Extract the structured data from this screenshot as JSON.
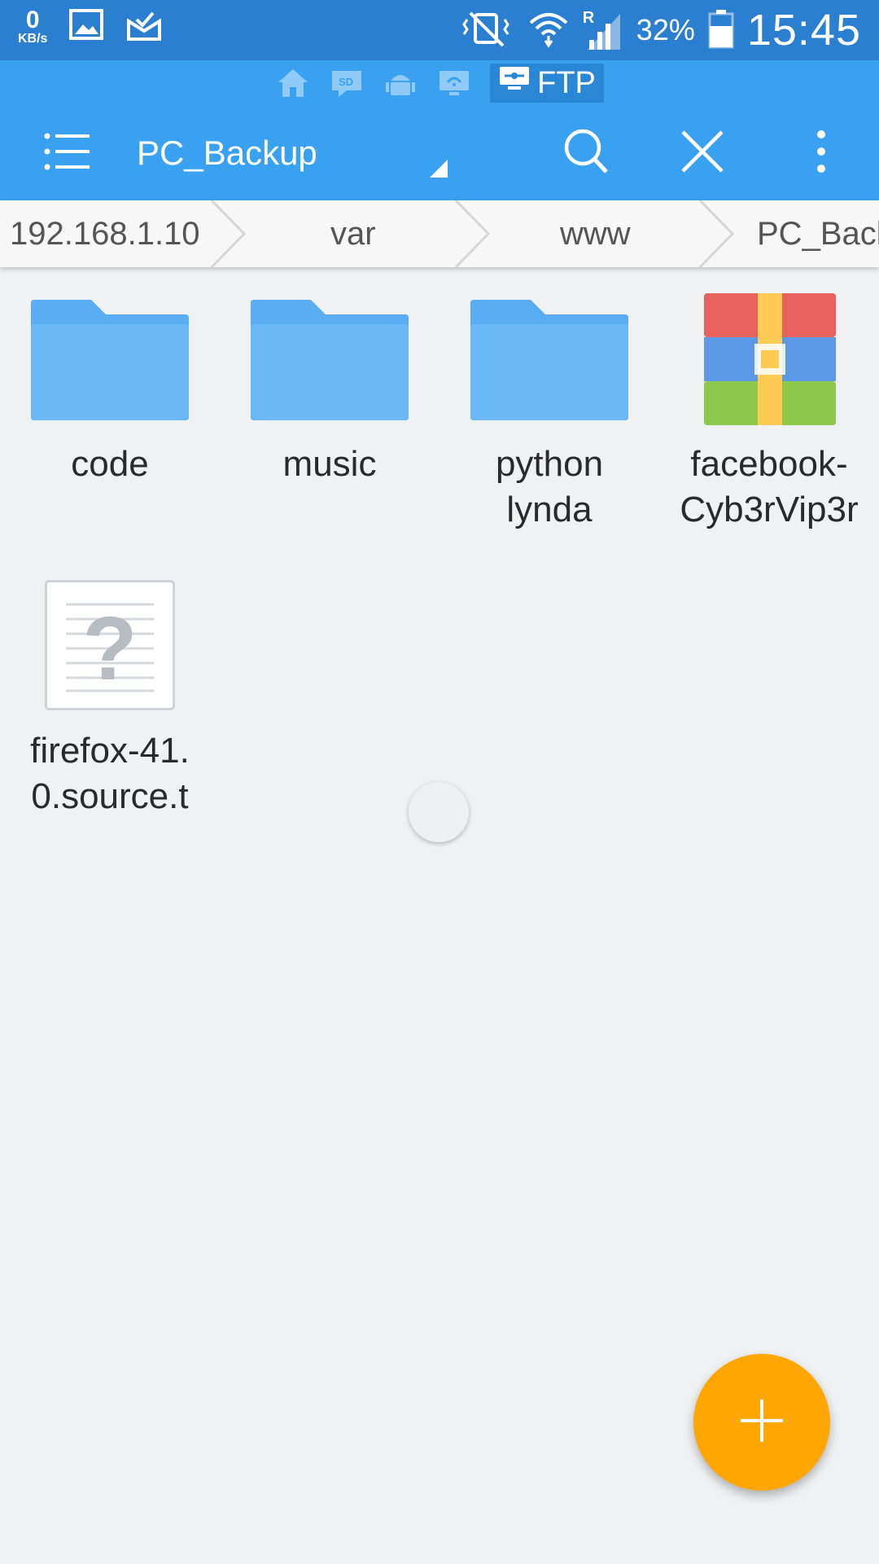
{
  "status_bar": {
    "net_speed_value": "0",
    "net_speed_unit": "KB/s",
    "roaming_indicator": "R",
    "battery_percent": "32%",
    "time": "15:45",
    "icons": [
      "image-icon",
      "mail-check-icon",
      "vibrate-mute-icon",
      "wifi-icon",
      "signal-icon",
      "battery-icon"
    ]
  },
  "mode_bar": {
    "items": [
      "home-icon",
      "sd-card-icon",
      "android-icon",
      "wifi-share-icon"
    ],
    "active_label": "FTP"
  },
  "toolbar": {
    "title": "PC_Backup",
    "icons": [
      "menu-icon",
      "search-icon",
      "close-icon",
      "more-vert-icon"
    ]
  },
  "breadcrumb": [
    "192.168.1.10",
    "var",
    "www",
    "PC_Backup"
  ],
  "files": [
    {
      "name": "code",
      "type": "folder"
    },
    {
      "name": "music",
      "type": "folder"
    },
    {
      "name": "python\nlynda",
      "type": "folder"
    },
    {
      "name": "facebook-\nCyb3rVip3r",
      "type": "archive"
    },
    {
      "name": "firefox-41.\n0.source.t",
      "type": "unknown"
    }
  ],
  "fab_icon": "plus-icon",
  "colors": {
    "status_bar": "#2a7fd0",
    "app_bar": "#3aa1f0",
    "folder": "#64b5f6",
    "fab": "#ffa600"
  }
}
